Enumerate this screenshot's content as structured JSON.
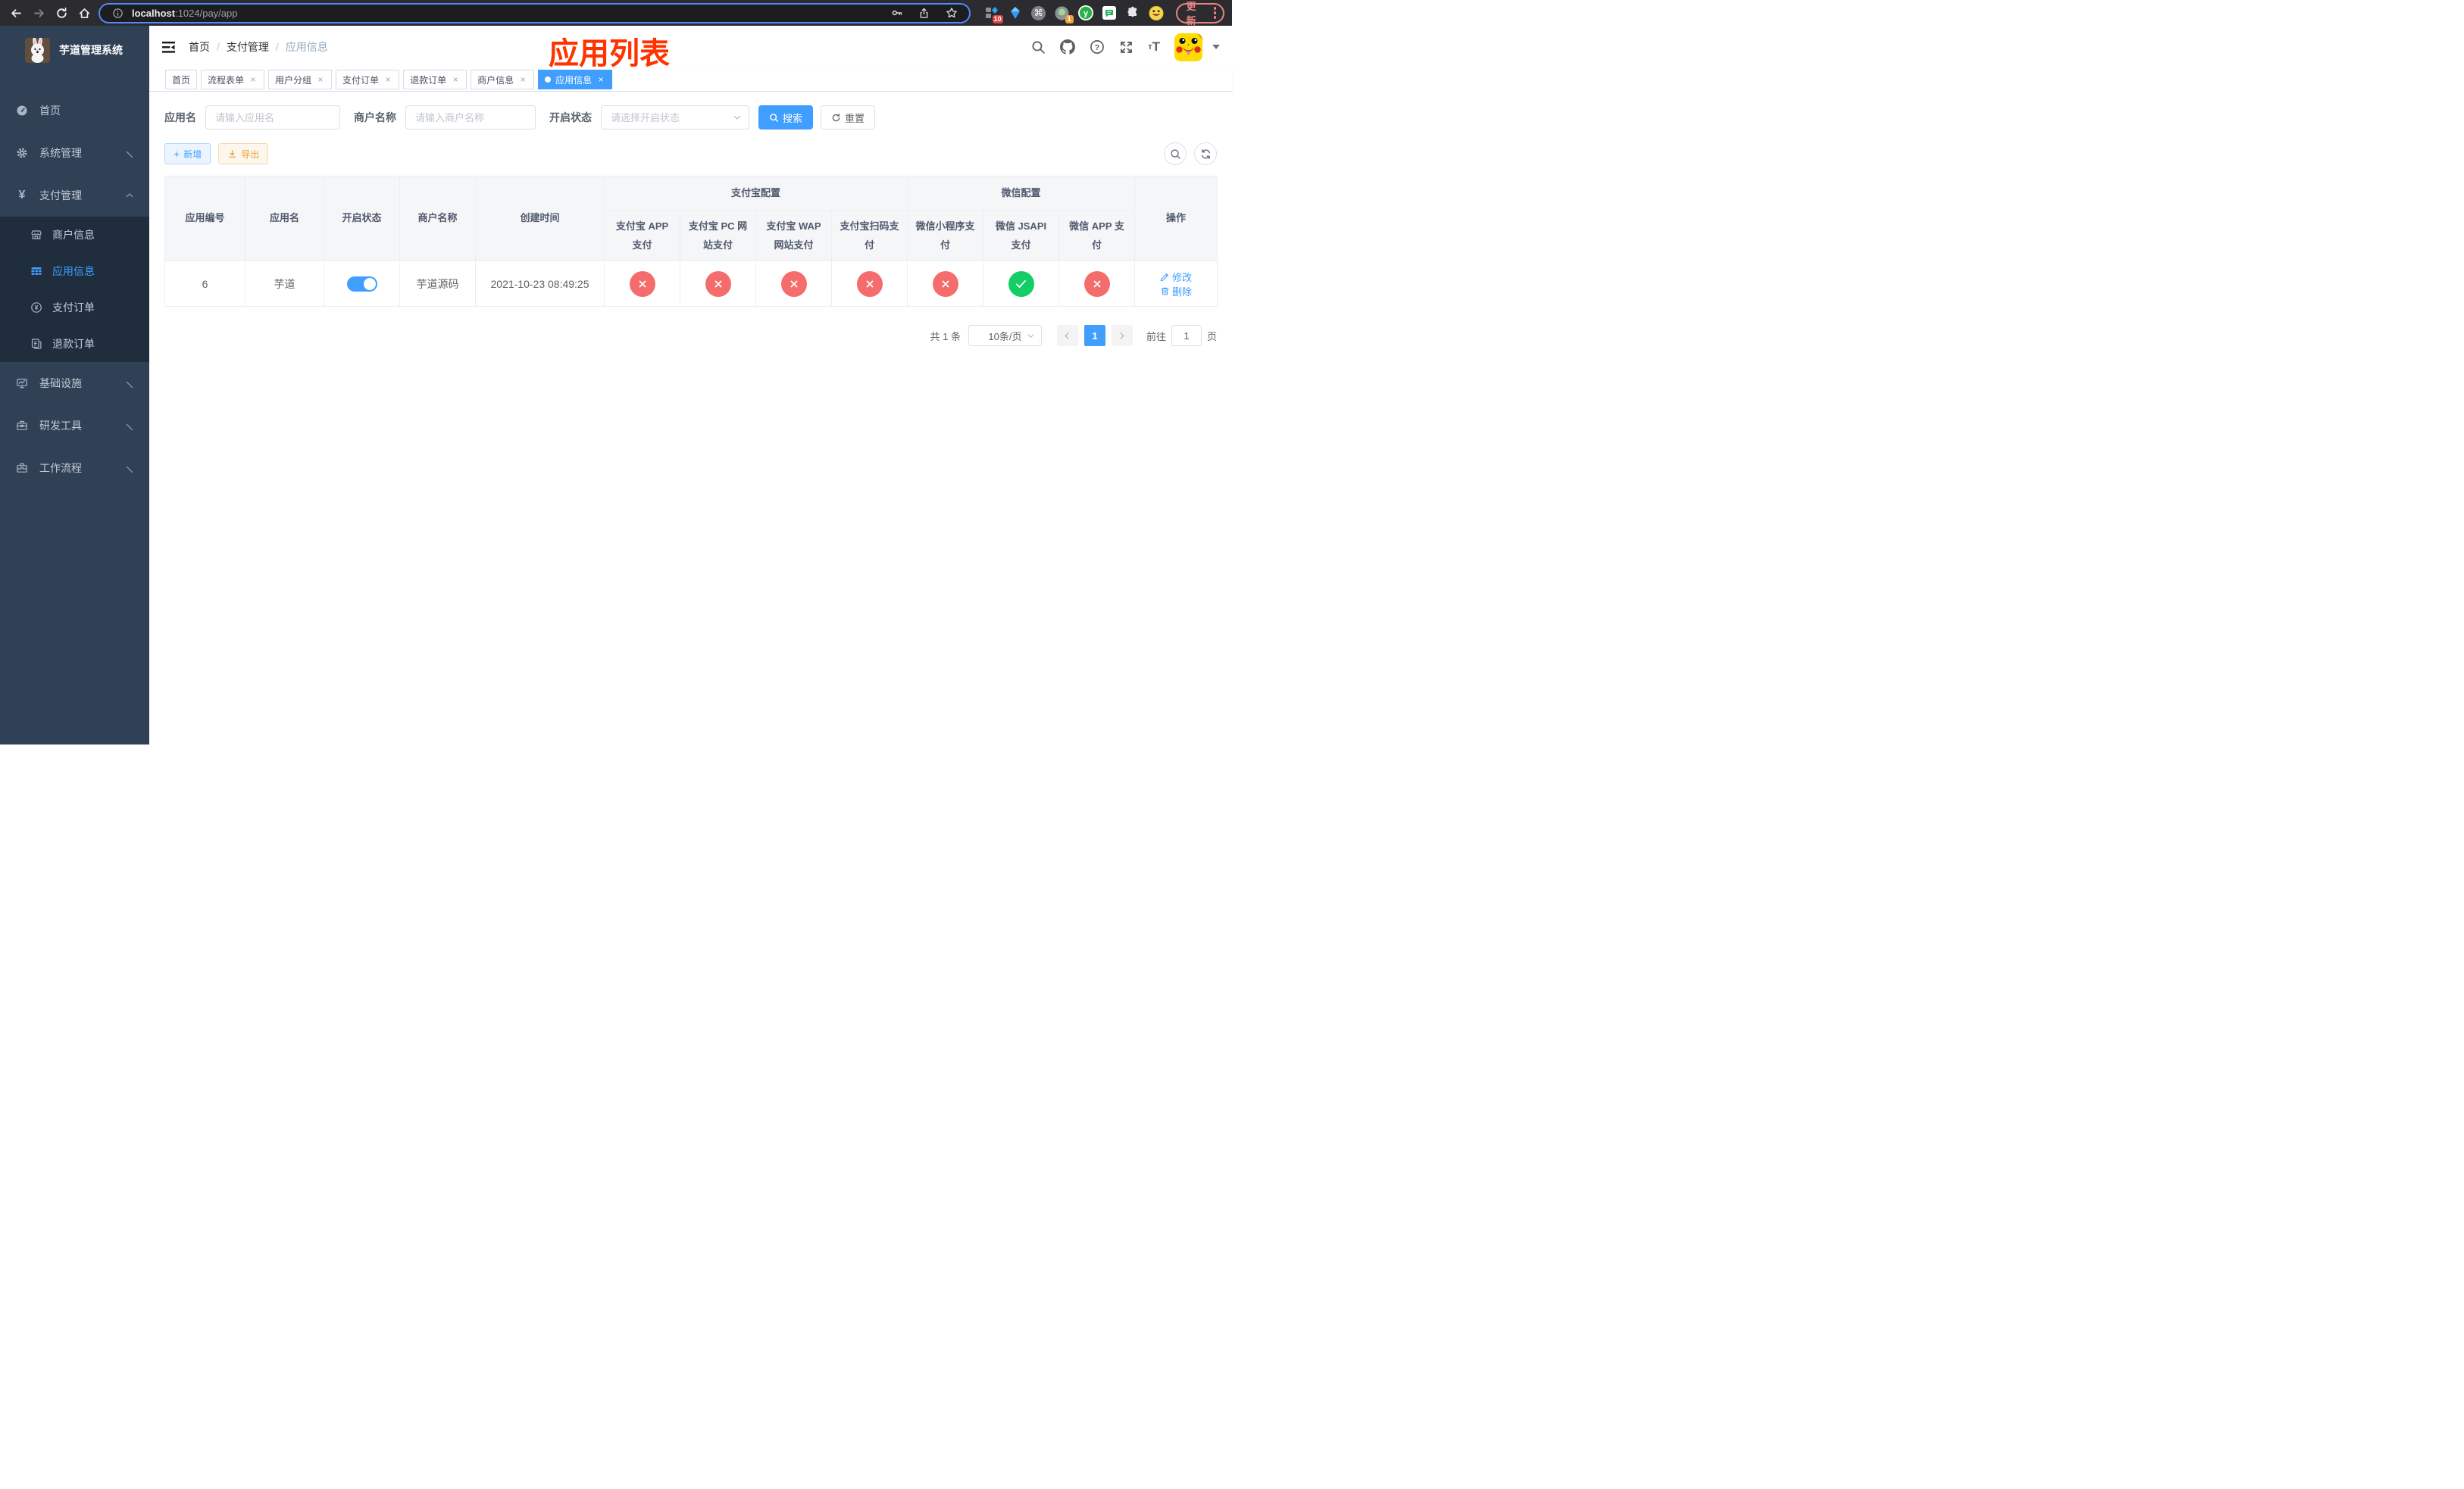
{
  "browser": {
    "url_host": "localhost",
    "url_path": ":1024/pay/app",
    "update_label": "更新",
    "ext_badge_blocker": "10",
    "ext_badge_proxy": "1",
    "ext_letter": "y"
  },
  "sidebar": {
    "title": "芋道管理系统",
    "items": [
      {
        "label": "首页",
        "icon": "dashboard-icon",
        "type": "top"
      },
      {
        "label": "系统管理",
        "icon": "gear-icon",
        "type": "top",
        "chevron": "down"
      },
      {
        "label": "支付管理",
        "icon": "yen-icon",
        "type": "top",
        "chevron": "up"
      },
      {
        "label": "商户信息",
        "icon": "shop-icon",
        "type": "sub"
      },
      {
        "label": "应用信息",
        "icon": "grid-icon",
        "type": "sub",
        "active": true
      },
      {
        "label": "支付订单",
        "icon": "yen-circle-icon",
        "type": "sub"
      },
      {
        "label": "退款订单",
        "icon": "document-icon",
        "type": "sub"
      },
      {
        "label": "基础设施",
        "icon": "monitor-icon",
        "type": "top",
        "chevron": "down"
      },
      {
        "label": "研发工具",
        "icon": "toolbox-icon",
        "type": "top",
        "chevron": "down"
      },
      {
        "label": "工作流程",
        "icon": "briefcase-icon",
        "type": "top",
        "chevron": "down"
      }
    ]
  },
  "header": {
    "breadcrumb": [
      "首页",
      "支付管理",
      "应用信息"
    ],
    "overlay_title": "应用列表"
  },
  "tabs": [
    {
      "label": "首页",
      "closable": false,
      "active": false
    },
    {
      "label": "流程表单",
      "closable": true,
      "active": false
    },
    {
      "label": "用户分组",
      "closable": true,
      "active": false
    },
    {
      "label": "支付订单",
      "closable": true,
      "active": false
    },
    {
      "label": "退款订单",
      "closable": true,
      "active": false
    },
    {
      "label": "商户信息",
      "closable": true,
      "active": false
    },
    {
      "label": "应用信息",
      "closable": true,
      "active": true
    }
  ],
  "filters": {
    "app_name_label": "应用名",
    "app_name_placeholder": "请输入应用名",
    "merchant_label": "商户名称",
    "merchant_placeholder": "请输入商户名称",
    "status_label": "开启状态",
    "status_placeholder": "请选择开启状态",
    "search_label": "搜索",
    "reset_label": "重置"
  },
  "toolbar": {
    "add_label": "新增",
    "export_label": "导出"
  },
  "table": {
    "col_headers": [
      "应用编号",
      "应用名",
      "开启状态",
      "商户名称",
      "创建时间"
    ],
    "groups": [
      {
        "label": "支付宝配置",
        "children": [
          "支付宝 APP 支付",
          "支付宝 PC 网站支付",
          "支付宝 WAP 网站支付",
          "支付宝扫码支付"
        ]
      },
      {
        "label": "微信配置",
        "children": [
          "微信小程序支付",
          "微信 JSAPI 支付",
          "微信 APP 支付"
        ]
      }
    ],
    "action_header": "操作",
    "rows": [
      {
        "id": "6",
        "name": "芋道",
        "enabled": true,
        "merchant": "芋道源码",
        "created": "2021-10-23 08:49:25",
        "statuses": [
          false,
          false,
          false,
          false,
          false,
          true,
          false
        ],
        "edit_label": "修改",
        "delete_label": "删除"
      }
    ]
  },
  "pagination": {
    "total": "共 1 条",
    "page_size": "10条/页",
    "current_page": "1",
    "goto_label": "前往",
    "goto_value": "1",
    "page_unit": "页"
  },
  "colors": {
    "primary": "#409eff",
    "success": "#13ce66",
    "danger": "#f56c6c",
    "warning": "#e6a23c",
    "overlay_title": "#ff3300",
    "sidebar_bg": "#304156",
    "submenu_bg": "#1f2d3d"
  }
}
